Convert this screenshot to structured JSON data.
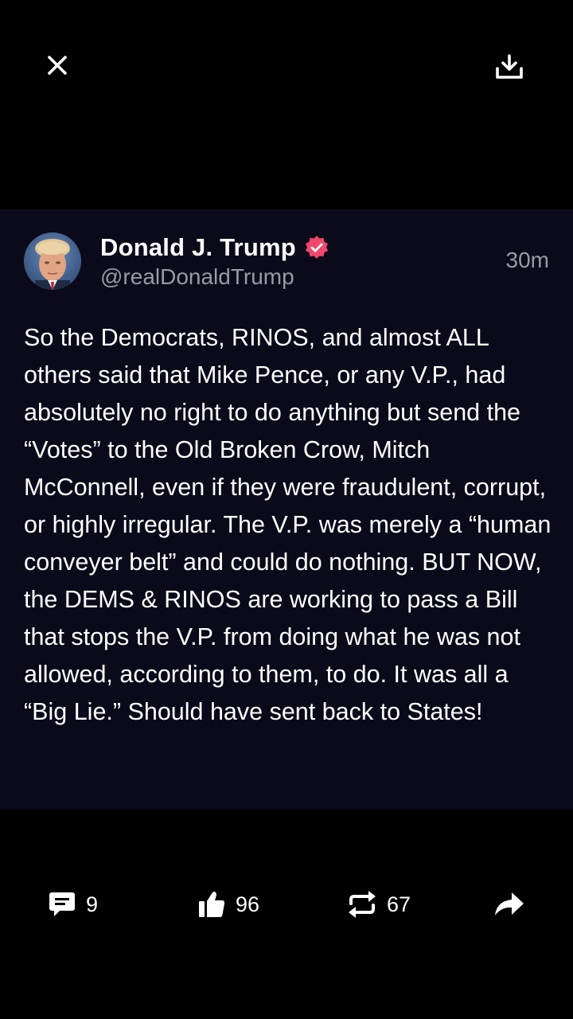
{
  "top_bar": {
    "close_icon": "close-icon",
    "download_icon": "download-icon"
  },
  "post": {
    "author": {
      "name": "Donald J. Trump",
      "handle": "@realDonaldTrump",
      "verified": true,
      "badge_color": "#f0476b"
    },
    "timestamp": "30m",
    "text": "So the Democrats, RINOS, and almost ALL others said that Mike Pence, or any V.P., had absolutely no right to do anything but send the “Votes” to the Old Broken Crow, Mitch McConnell, even if they were fraudulent, corrupt, or highly irregular. The V.P. was merely a “human conveyer belt” and could do nothing. BUT NOW, the DEMS & RINOS are working to pass a Bill that stops the V.P. from doing what he was not allowed, according to them, to do. It was all a “Big Lie.” Should have sent back to States!"
  },
  "actions": {
    "replies": "9",
    "likes": "96",
    "retruths": "67",
    "reply_icon": "comment-icon",
    "like_icon": "thumbs-up-icon",
    "retruth_icon": "repost-icon",
    "share_icon": "share-arrow-icon"
  },
  "colors": {
    "background": "#000000",
    "card_background": "#0b0a1a",
    "secondary_text": "#9a9aa6",
    "verified": "#f0476b"
  }
}
